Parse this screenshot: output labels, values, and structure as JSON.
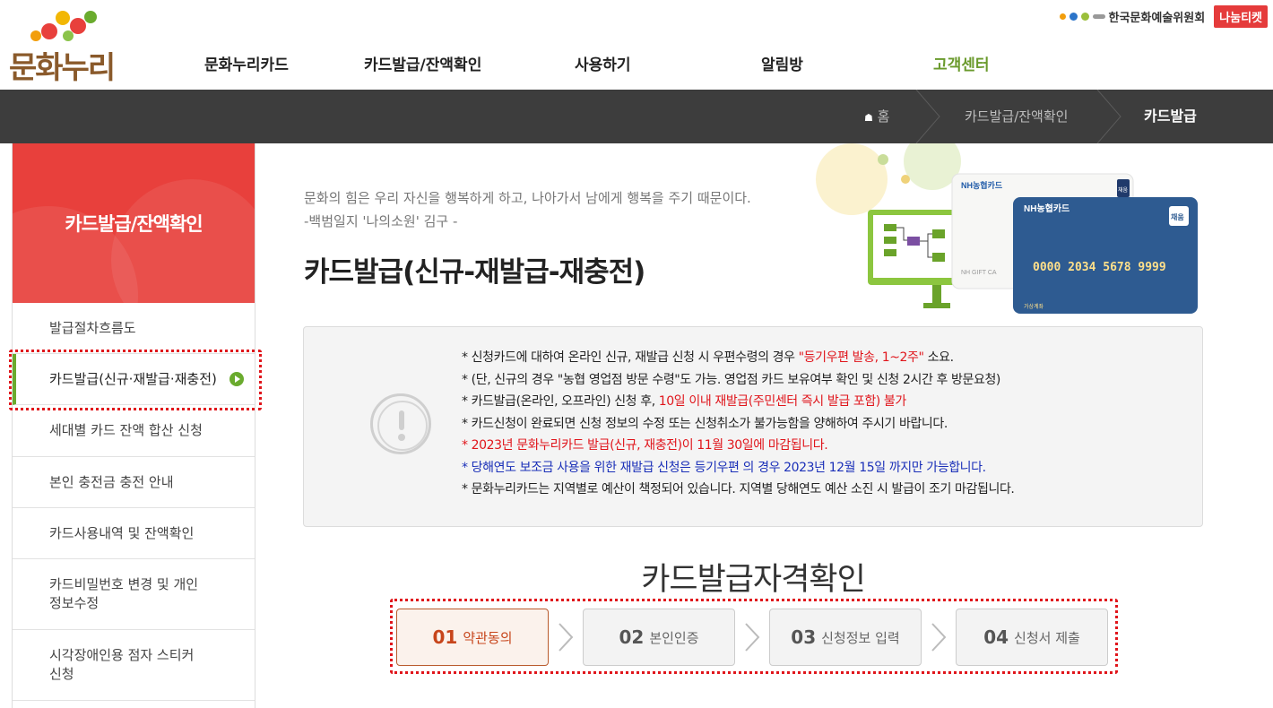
{
  "header": {
    "logo_text": "문화누리",
    "nav": [
      {
        "label": "문화누리카드"
      },
      {
        "label": "카드발급/잔액확인"
      },
      {
        "label": "사용하기"
      },
      {
        "label": "알림방"
      },
      {
        "label": "고객센터"
      }
    ],
    "util": {
      "arko_label": "한국문화예술위원회",
      "nanum_label": "나눔티켓"
    }
  },
  "breadcrumb": {
    "home": "홈",
    "level1": "카드발급/잔액확인",
    "current": "카드발급"
  },
  "sidebar": {
    "title": "카드발급/잔액확인",
    "items": [
      {
        "label": "발급절차흐름도"
      },
      {
        "label": "카드발급(신규·재발급·재충전)"
      },
      {
        "label": "세대별 카드 잔액 합산 신청"
      },
      {
        "label": "본인 충전금 충전 안내"
      },
      {
        "label": "카드사용내역 및 잔액확인"
      },
      {
        "label": "카드비밀번호 변경 및 개인정보수정"
      },
      {
        "label": "시각장애인용 점자 스티커 신청"
      }
    ]
  },
  "content": {
    "quote_line1": "문화의 힘은 우리 자신을 행복하게 하고, 나아가서 남에게 행복을 주기 때문이다.",
    "quote_line2": "-백범일지 '나의소원' 김구 -",
    "title": "카드발급(신규-재발급-재충전)",
    "card_front": {
      "brand": "NH농협카드",
      "number": "0000  2034  5678  9999",
      "badge": "채움",
      "holder_label": "가상계좌"
    },
    "card_back": {
      "brand": "NH농협카드",
      "badge": "채움",
      "gift": "NH GIFT CA"
    },
    "notice": {
      "l1_a": "* 신청카드에 대하여 온라인 신규, 재발급 신청 시 우편수령의 경우 ",
      "l1_b": "\"등기우편 발송, 1~2주\"",
      "l1_c": " 소요.",
      "l2": "* (단, 신규의 경우 \"농협 영업점 방문 수령\"도 가능. 영업점 카드 보유여부 확인 및 신청 2시간 후 방문요청)",
      "l3_a": "* 카드발급(온라인, 오프라인) 신청 후, ",
      "l3_b": "10일 이내 재발급(주민센터 즉시 발급 포함) 불가",
      "l4": "* 카드신청이 완료되면 신청 정보의 수정 또는 신청취소가 불가능함을 양해하여 주시기 바랍니다.",
      "l5": "* 2023년 문화누리카드 발급(신규, 재충전)이 11월 30일에 마감됩니다.",
      "l6": "* 당해연도 보조금 사용을 위한 재발급 신청은 등기우편 의 경우 2023년 12월 15일 까지만 가능합니다.",
      "l7": "* 문화누리카드는 지역별로 예산이 책정되어 있습니다. 지역별 당해연도 예산 소진 시 발급이 조기 마감됩니다."
    },
    "section_title": "카드발급자격확인",
    "steps": [
      {
        "num": "01",
        "label": "약관동의"
      },
      {
        "num": "02",
        "label": "본인인증"
      },
      {
        "num": "03",
        "label": "신청정보 입력"
      },
      {
        "num": "04",
        "label": "신청서 제출"
      }
    ]
  },
  "colors": {
    "brand_red": "#e8403c",
    "accent_green": "#6aab2e",
    "notice_red": "#e0151b",
    "notice_blue": "#1a2fb8",
    "dark_bar": "#3d3d3d"
  }
}
